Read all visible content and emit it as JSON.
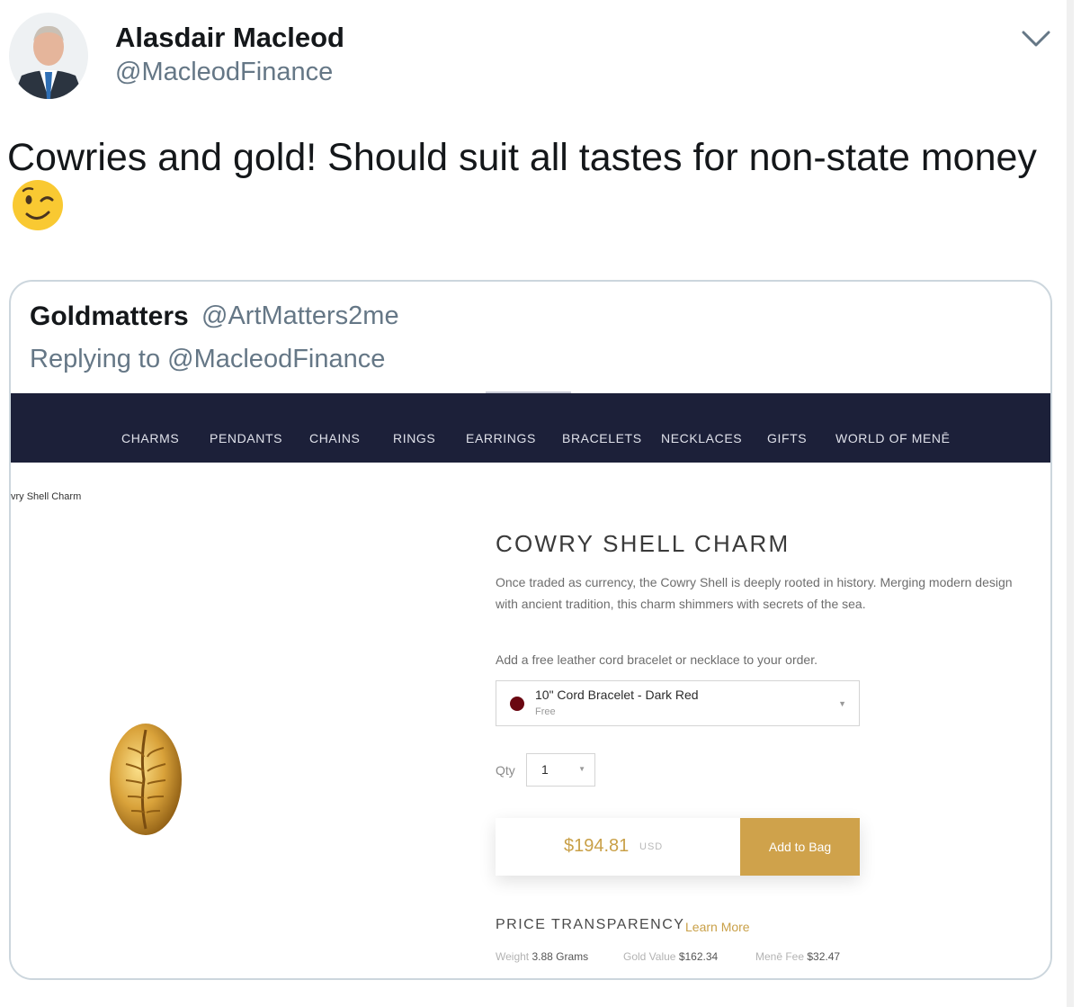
{
  "tweet": {
    "author_name": "Alasdair Macleod",
    "author_handle": "@MacleodFinance",
    "text": "Cowries and gold! Should suit all tastes for non-state money",
    "emoji": "winking-face"
  },
  "quoted": {
    "author_name": "Goldmatters",
    "author_handle": "@ArtMatters2me",
    "reply_line": "Replying to @MacleodFinance",
    "shop": {
      "nav": [
        "CHARMS",
        "PENDANTS",
        "CHAINS",
        "RINGS",
        "EARRINGS",
        "BRACELETS",
        "NECKLACES",
        "GIFTS",
        "WORLD OF MENĒ"
      ],
      "breadcrumb": "vry Shell Charm",
      "product_title": "COWRY SHELL CHARM",
      "description": "Once traded as currency, the Cowry Shell is deeply rooted in history. Merging modern design with ancient tradition, this charm shimmers with secrets of the sea.",
      "offer_text": "Add a free leather cord bracelet or necklace to your order.",
      "select_label": "10\" Cord Bracelet - Dark Red",
      "select_sub": "Free",
      "select_color": "#6a0711",
      "qty_label": "Qty",
      "qty_value": "1",
      "price": "$194.81",
      "currency": "USD",
      "add_button": "Add to Bag",
      "transparency_title": "PRICE TRANSPARENCY",
      "learn_more": "Learn More",
      "weight_label": "Weight",
      "weight_value": "3.88 Grams",
      "gold_label": "Gold Value",
      "gold_value": "$162.34",
      "fee_label": "Menē Fee",
      "fee_value": "$32.47",
      "accent_color": "#cfa24b",
      "nav_bg": "#1c2039"
    }
  }
}
